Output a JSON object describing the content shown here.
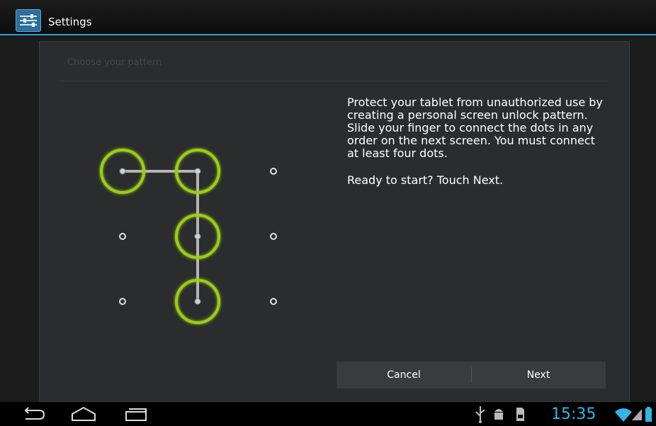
{
  "app": {
    "title": "Settings",
    "icon": "settings-app-icon"
  },
  "dialog": {
    "header": "Choose your pattern",
    "instructions": "Protect your tablet from unauthorized use by creating a personal screen unlock pattern. Slide your finger to connect the dots in any order on the next screen. You must connect at least four dots.",
    "ready": "Ready to start? Touch Next.",
    "buttons": {
      "cancel": "Cancel",
      "next": "Next"
    }
  },
  "pattern": {
    "grid": "3x3",
    "highlighted_dots": [
      1,
      2,
      5,
      8
    ],
    "path_order": [
      1,
      2,
      5,
      8
    ],
    "highlight_color": "#9acd14",
    "line_color": "#b5b5b5"
  },
  "status_bar": {
    "time": "15:35",
    "icons": [
      "back-icon",
      "home-icon",
      "recent-apps-icon",
      "usb-icon",
      "android-debug-icon",
      "sd-card-icon",
      "wifi-icon",
      "signal-icon",
      "battery-icon"
    ],
    "accent_color": "#33b5e5"
  }
}
